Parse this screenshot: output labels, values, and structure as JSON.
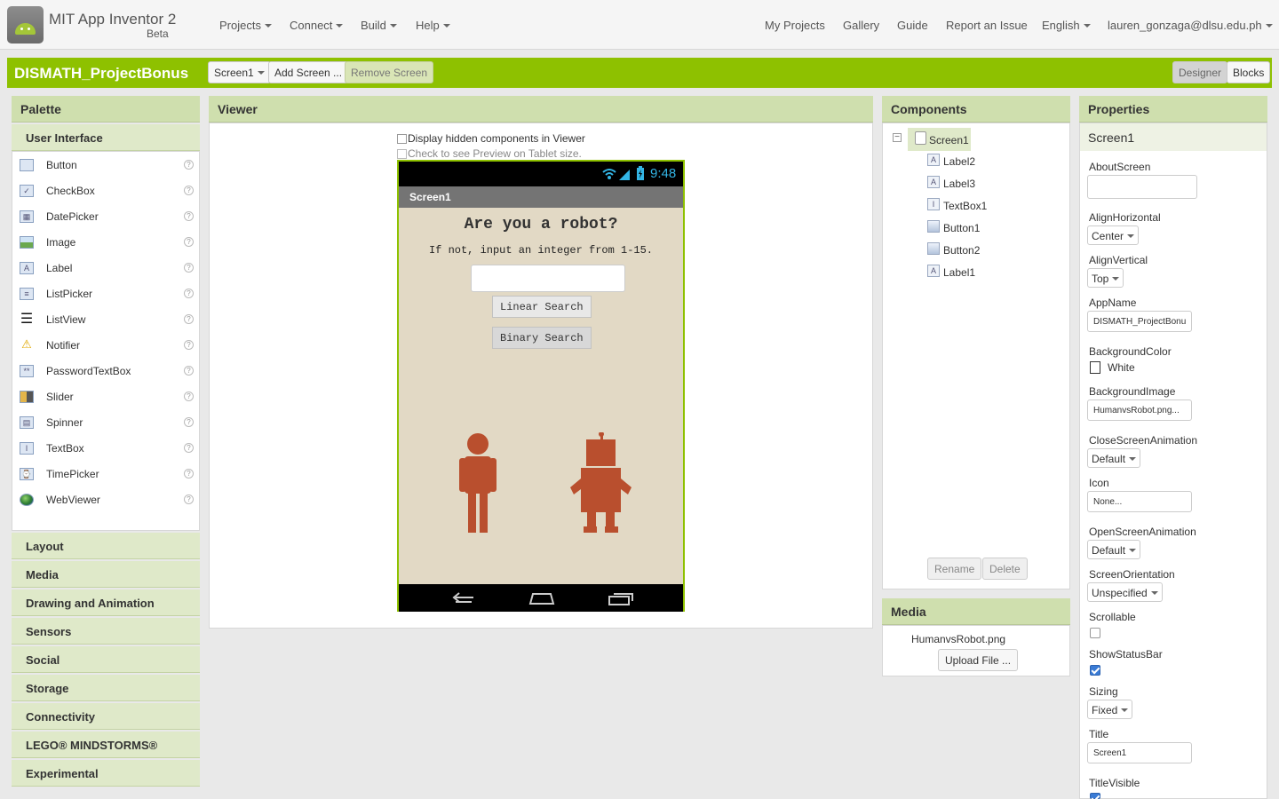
{
  "app": {
    "name": "MIT App Inventor 2",
    "badge": "Beta"
  },
  "topnav": {
    "left": [
      "Projects",
      "Connect",
      "Build",
      "Help"
    ],
    "right": [
      "My Projects",
      "Gallery",
      "Guide",
      "Report an Issue",
      "English",
      "lauren_gonzaga@dlsu.edu.ph"
    ]
  },
  "project": {
    "title": "DISMATH_ProjectBonus",
    "screen_select": "Screen1",
    "add_screen": "Add Screen ...",
    "remove_screen": "Remove Screen",
    "designer": "Designer",
    "blocks": "Blocks"
  },
  "palette": {
    "title": "Palette",
    "open_category": "User Interface",
    "items": [
      "Button",
      "CheckBox",
      "DatePicker",
      "Image",
      "Label",
      "ListPicker",
      "ListView",
      "Notifier",
      "PasswordTextBox",
      "Slider",
      "Spinner",
      "TextBox",
      "TimePicker",
      "WebViewer"
    ],
    "help_glyph": "?",
    "categories": [
      "Layout",
      "Media",
      "Drawing and Animation",
      "Sensors",
      "Social",
      "Storage",
      "Connectivity",
      "LEGO® MINDSTORMS®",
      "Experimental"
    ]
  },
  "viewer": {
    "title": "Viewer",
    "hidden_check": "Display hidden components in Viewer",
    "tablet_check": "Check to see Preview on Tablet size.",
    "phone": {
      "time": "9:48",
      "screen_title": "Screen1",
      "heading": "Are you a robot?",
      "subheading": "If not, input an integer from 1-15.",
      "textbox_value": "",
      "button1": "Linear Search",
      "button2": "Binary Search",
      "accent": "#b94f2e"
    }
  },
  "components": {
    "title": "Components",
    "root": "Screen1",
    "items": [
      {
        "name": "Label2",
        "icon": "label-icon",
        "glyph": "A"
      },
      {
        "name": "Label3",
        "icon": "label-icon",
        "glyph": "A"
      },
      {
        "name": "TextBox1",
        "icon": "textbox-icon",
        "glyph": "I"
      },
      {
        "name": "Button1",
        "icon": "button-icon",
        "glyph": ""
      },
      {
        "name": "Button2",
        "icon": "button-icon",
        "glyph": ""
      },
      {
        "name": "Label1",
        "icon": "label-icon",
        "glyph": "A"
      }
    ],
    "rename": "Rename",
    "delete": "Delete"
  },
  "media": {
    "title": "Media",
    "file": "HumanvsRobot.png",
    "upload": "Upload File ..."
  },
  "properties": {
    "title": "Properties",
    "selected": "Screen1",
    "about_label": "AboutScreen",
    "about_value": "",
    "align_h_label": "AlignHorizontal",
    "align_h_value": "Center",
    "align_v_label": "AlignVertical",
    "align_v_value": "Top",
    "appname_label": "AppName",
    "appname_value": "DISMATH_ProjectBonu",
    "bgcolor_label": "BackgroundColor",
    "bgcolor_value": "White",
    "bgimage_label": "BackgroundImage",
    "bgimage_value": "HumanvsRobot.png...",
    "close_anim_label": "CloseScreenAnimation",
    "close_anim_value": "Default",
    "icon_label": "Icon",
    "icon_value": "None...",
    "open_anim_label": "OpenScreenAnimation",
    "open_anim_value": "Default",
    "orientation_label": "ScreenOrientation",
    "orientation_value": "Unspecified",
    "scrollable_label": "Scrollable",
    "scrollable": false,
    "statusbar_label": "ShowStatusBar",
    "statusbar": true,
    "sizing_label": "Sizing",
    "sizing_value": "Fixed",
    "title_label": "Title",
    "title_value": "Screen1",
    "titlevisible_label": "TitleVisible",
    "titlevisible": true
  },
  "colors": {
    "brand_green": "#8ec100",
    "panel_header": "#cfdfae",
    "phone_bg": "#e2d9c5",
    "figure": "#b94f2e"
  }
}
